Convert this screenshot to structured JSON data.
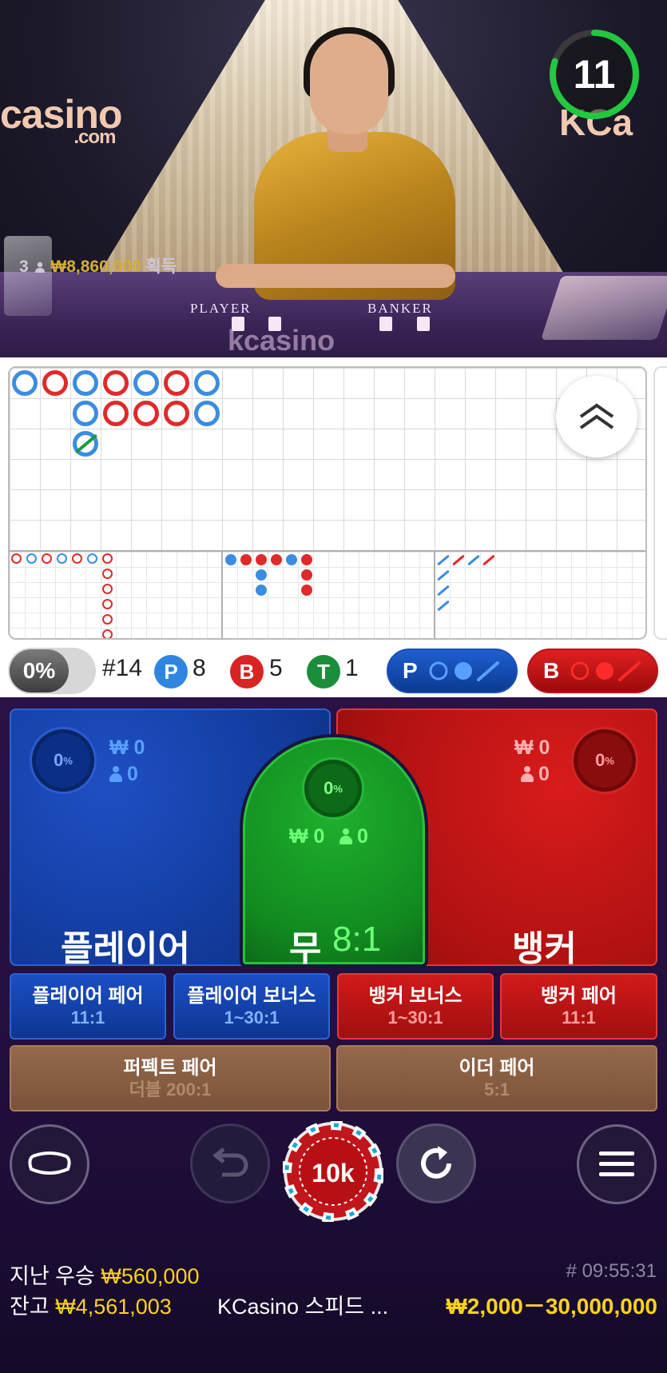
{
  "video": {
    "logo_left": "casino",
    "logo_left_sub": ".com",
    "logo_right": "KCa",
    "logo_table": "kcasino",
    "label_player": "PLAYER",
    "label_banker": "BANKER",
    "winners_count": "3",
    "winners_amount": "₩8,860,000",
    "winners_suffix": "획득",
    "timer": "11",
    "timer_progress": 0.8
  },
  "roadmap": {
    "expand_icon": "double-chevron-up-icon",
    "bead_row1": [
      "P",
      "B",
      "P",
      "B",
      "P",
      "B",
      "P"
    ],
    "bead_row2": [
      "P",
      "B",
      "B",
      "B",
      "P"
    ]
  },
  "stats": {
    "percent": "0%",
    "round": "#14",
    "player_letter": "P",
    "player_count": "8",
    "banker_letter": "B",
    "banker_count": "5",
    "tie_letter": "T",
    "tie_count": "1",
    "predict_player": "P",
    "predict_banker": "B"
  },
  "bets": {
    "player": {
      "title": "플레이어",
      "percent": "0",
      "pct_sign": "%",
      "amount": "₩ 0",
      "players": "0"
    },
    "tie": {
      "title": "무",
      "odds": "8:1",
      "percent": "0",
      "pct_sign": "%",
      "amount": "₩ 0",
      "players": "0"
    },
    "banker": {
      "title": "뱅커",
      "percent": "0",
      "pct_sign": "%",
      "amount": "₩ 0",
      "players": "0"
    },
    "side": [
      {
        "title": "플레이어 페어",
        "odds": "11:1"
      },
      {
        "title": "플레이어 보너스",
        "odds": "1~30:1"
      },
      {
        "title": "뱅커 보너스",
        "odds": "1~30:1"
      },
      {
        "title": "뱅커 페어",
        "odds": "11:1"
      }
    ],
    "perfect_pair": {
      "title": "퍼펙트 페어",
      "odds": "더블 200:1"
    },
    "either_pair": {
      "title": "이더 페어",
      "odds": "5:1"
    }
  },
  "controls": {
    "table_icon": "table-icon",
    "undo_icon": "undo-icon",
    "chip_value": "10k",
    "repeat_icon": "repeat-icon",
    "menu_icon": "menu-icon"
  },
  "footer": {
    "last_win_label": "지난 우승",
    "last_win_amount": "₩560,000",
    "balance_label": "잔고",
    "balance_amount": "₩4,561,003",
    "table_name": "KCasino 스피드 ...",
    "round_time": "# 09:55:31",
    "limits": "₩2,000－30,000,000"
  },
  "colors": {
    "player_blue": "#1a4fc4",
    "banker_red": "#d21a1a",
    "tie_green": "#1eb02c",
    "gold": "#ffd21e"
  }
}
